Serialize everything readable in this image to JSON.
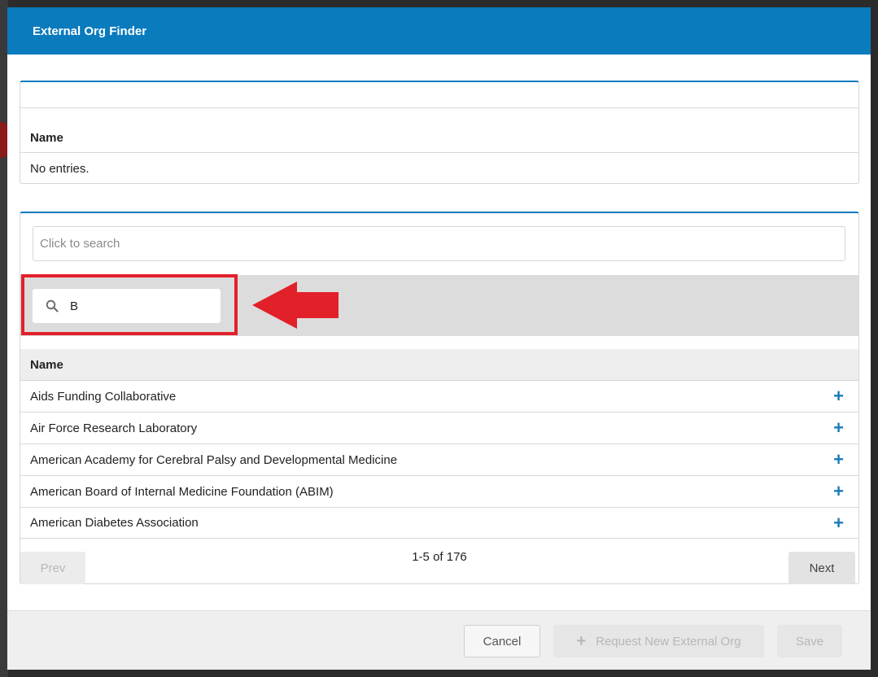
{
  "dialog": {
    "title": "External Org Finder",
    "header_color": "#0a7bbd"
  },
  "selected_panel": {
    "column_header": "Name",
    "empty_message": "No entries."
  },
  "search": {
    "placeholder": "Click to search",
    "filter_value": "B",
    "filter_icon": "search-icon"
  },
  "annotation": {
    "highlight_color": "#e2202a",
    "arrow": "left-arrow"
  },
  "results": {
    "column_header": "Name",
    "rows": [
      {
        "name": "Aids Funding Collaborative",
        "action_icon": "plus-icon"
      },
      {
        "name": "Air Force Research Laboratory",
        "action_icon": "plus-icon"
      },
      {
        "name": "American Academy for Cerebral Palsy and Developmental Medicine",
        "action_icon": "plus-icon"
      },
      {
        "name": "American Board of Internal Medicine Foundation (ABIM)",
        "action_icon": "plus-icon"
      },
      {
        "name": "American Diabetes Association",
        "action_icon": "plus-icon"
      }
    ]
  },
  "pagination": {
    "prev_label": "Prev",
    "next_label": "Next",
    "summary": "1-5 of 176"
  },
  "footer": {
    "cancel_label": "Cancel",
    "request_label": "Request New External Org",
    "request_icon": "plus-icon",
    "save_label": "Save"
  }
}
